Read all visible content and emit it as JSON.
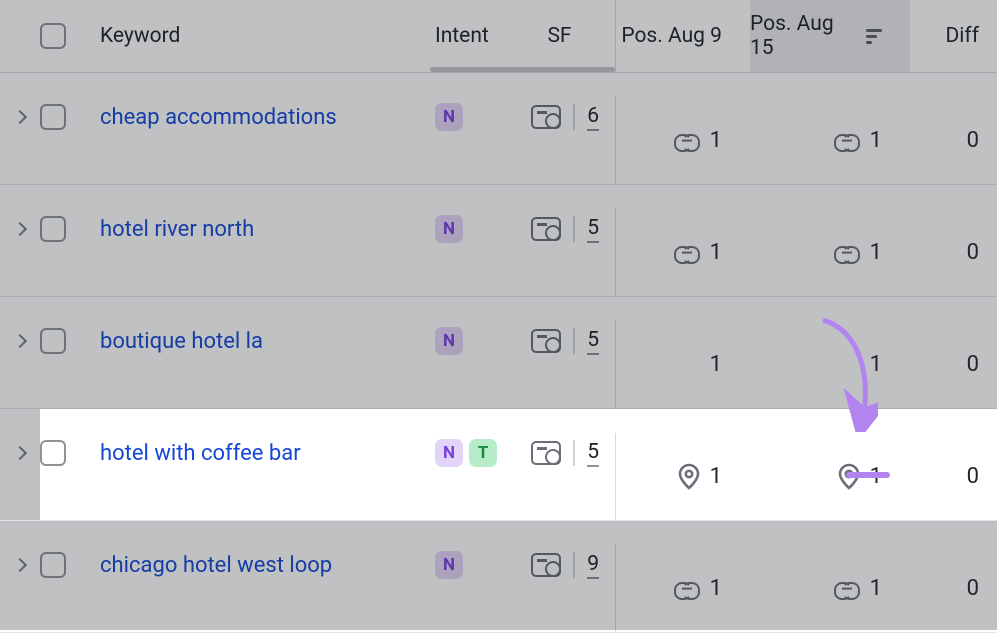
{
  "columns": {
    "keyword": "Keyword",
    "intent": "Intent",
    "sf": "SF",
    "pos1": "Pos. Aug 9",
    "pos2": "Pos. Aug 15",
    "diff": "Diff"
  },
  "rows": [
    {
      "keyword": "cheap accommodations",
      "intents": [
        "N"
      ],
      "sf": "6",
      "pos1": {
        "icon": "link",
        "value": "1"
      },
      "pos2": {
        "icon": "link",
        "value": "1"
      },
      "diff": "0"
    },
    {
      "keyword": "hotel river north",
      "intents": [
        "N"
      ],
      "sf": "5",
      "pos1": {
        "icon": "link",
        "value": "1"
      },
      "pos2": {
        "icon": "link",
        "value": "1"
      },
      "diff": "0"
    },
    {
      "keyword": "boutique hotel la",
      "intents": [
        "N"
      ],
      "sf": "5",
      "pos1": {
        "icon": "none",
        "value": "1"
      },
      "pos2": {
        "icon": "none",
        "value": "1"
      },
      "diff": "0"
    },
    {
      "keyword": "hotel with coffee bar",
      "intents": [
        "N",
        "T"
      ],
      "sf": "5",
      "pos1": {
        "icon": "pin",
        "value": "1"
      },
      "pos2": {
        "icon": "pin",
        "value": "1"
      },
      "diff": "0",
      "highlight": true
    },
    {
      "keyword": "chicago hotel west loop",
      "intents": [
        "N"
      ],
      "sf": "9",
      "pos1": {
        "icon": "link",
        "value": "1"
      },
      "pos2": {
        "icon": "link",
        "value": "1"
      },
      "diff": "0"
    }
  ]
}
